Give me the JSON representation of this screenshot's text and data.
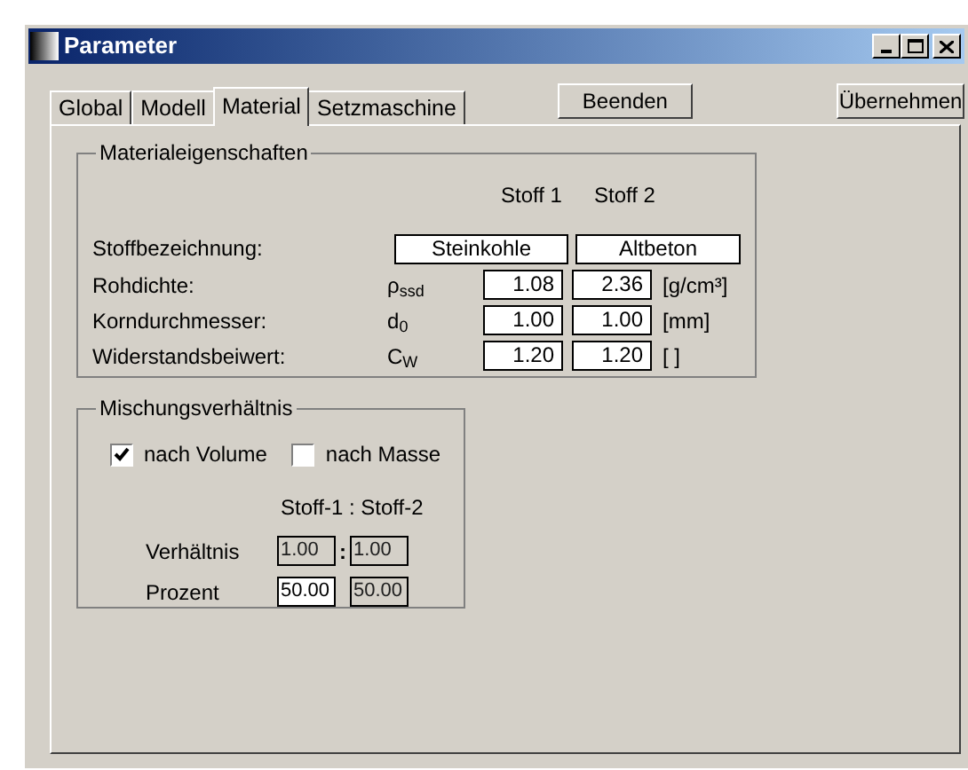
{
  "window": {
    "title": "Parameter"
  },
  "tabs": [
    {
      "label": "Global",
      "selected": false
    },
    {
      "label": "Modell",
      "selected": false
    },
    {
      "label": "Material",
      "selected": true
    },
    {
      "label": "Setzmaschine",
      "selected": false
    }
  ],
  "buttons": [
    "Beenden",
    "Übernehmen"
  ],
  "material": {
    "title": "Materialeigenschaften",
    "headers": [
      "Stoff 1",
      "Stoff 2"
    ],
    "name_row": {
      "label": "Stoffbezeichnung:",
      "values": [
        "Steinkohle",
        "Altbeton"
      ]
    },
    "rows": [
      {
        "label": "Rohdichte:",
        "symbol": "ρ$_{ssd}$",
        "values": [
          "1.08",
          "2.36"
        ],
        "unit": "[g/cm³]"
      },
      {
        "label": "Korndurchmesser:",
        "symbol": "d$_{0}$",
        "values": [
          "1.00",
          "1.00"
        ],
        "unit": "[mm]"
      },
      {
        "label": "Widerstandsbeiwert:",
        "symbol": "C$_{W}$",
        "values": [
          "1.20",
          "1.20"
        ],
        "unit": "[ ]"
      }
    ]
  },
  "mixing": {
    "title": "Mischungsverhältnis",
    "options": [
      {
        "label": "nach Volume",
        "checked": true
      },
      {
        "label": "nach Masse",
        "checked": false
      }
    ],
    "header": "Stoff-1 : Stoff-2",
    "rows": [
      {
        "label": "Verhältnis",
        "separator": ":",
        "fields": [
          {
            "value": "1.00",
            "disabled": true
          },
          {
            "value": "1.00",
            "disabled": true
          }
        ]
      },
      {
        "label": "Prozent",
        "fields": [
          {
            "value": "50.00",
            "disabled": false
          },
          {
            "value": "50.00",
            "disabled": true
          }
        ]
      }
    ]
  }
}
